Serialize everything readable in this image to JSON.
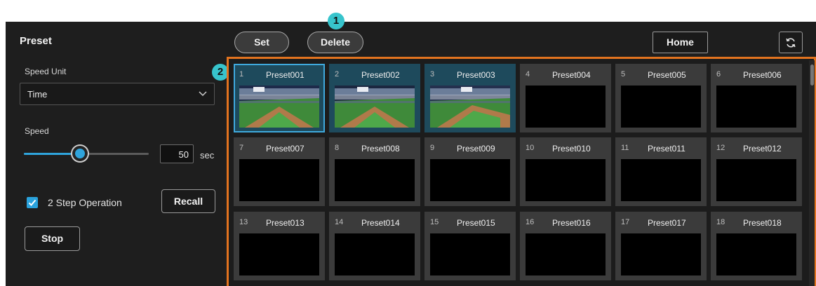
{
  "panel": {
    "title": "Preset"
  },
  "speed_unit": {
    "label": "Speed Unit",
    "value": "Time"
  },
  "speed": {
    "label": "Speed",
    "value": "50",
    "unit": "sec",
    "level": 0.45
  },
  "two_step": {
    "label": "2 Step Operation",
    "checked": true
  },
  "buttons": {
    "recall": "Recall",
    "stop": "Stop",
    "set": "Set",
    "delete": "Delete",
    "home": "Home"
  },
  "markers": {
    "one": "1",
    "two": "2"
  },
  "colors": {
    "accent": "#2fa4dc",
    "frame": "#e2731f",
    "marker": "#37c4cc"
  },
  "presets": [
    {
      "index": "1",
      "name": "Preset001",
      "has_thumbnail": true,
      "selected": true
    },
    {
      "index": "2",
      "name": "Preset002",
      "has_thumbnail": true
    },
    {
      "index": "3",
      "name": "Preset003",
      "has_thumbnail": true
    },
    {
      "index": "4",
      "name": "Preset004"
    },
    {
      "index": "5",
      "name": "Preset005"
    },
    {
      "index": "6",
      "name": "Preset006"
    },
    {
      "index": "7",
      "name": "Preset007"
    },
    {
      "index": "8",
      "name": "Preset008"
    },
    {
      "index": "9",
      "name": "Preset009"
    },
    {
      "index": "10",
      "name": "Preset010"
    },
    {
      "index": "11",
      "name": "Preset011"
    },
    {
      "index": "12",
      "name": "Preset012"
    },
    {
      "index": "13",
      "name": "Preset013"
    },
    {
      "index": "14",
      "name": "Preset014"
    },
    {
      "index": "15",
      "name": "Preset015"
    },
    {
      "index": "16",
      "name": "Preset016"
    },
    {
      "index": "17",
      "name": "Preset017"
    },
    {
      "index": "18",
      "name": "Preset018"
    }
  ]
}
